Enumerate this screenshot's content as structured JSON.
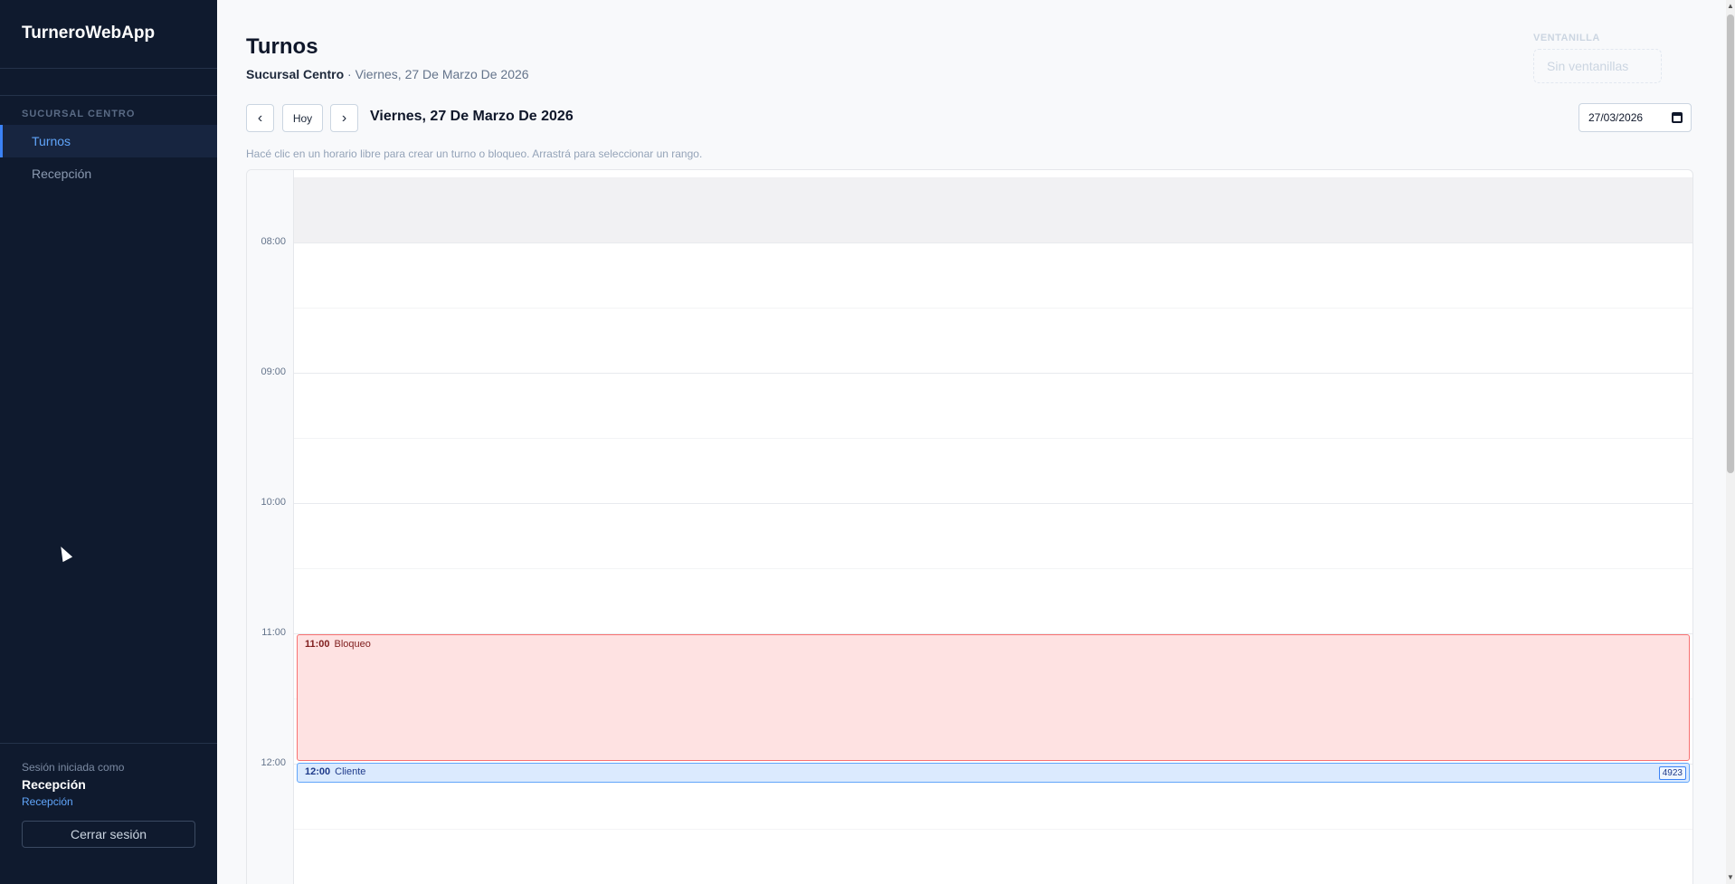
{
  "app": {
    "brand": "TurneroWebApp"
  },
  "sidebar": {
    "section": "SUCURSAL CENTRO",
    "items": [
      {
        "label": "Turnos",
        "active": true
      },
      {
        "label": "Recepción",
        "active": false
      }
    ],
    "session_label": "Sesión iniciada como",
    "user": "Recepción",
    "role": "Recepción",
    "logout_label": "Cerrar sesión"
  },
  "header": {
    "title": "Turnos",
    "branch": "Sucursal Centro",
    "separator": " · ",
    "date": "Viernes, 27 De Marzo De 2026",
    "ventanilla_label": "VENTANILLA",
    "ventanilla_placeholder": "Sin ventanillas"
  },
  "toolbar": {
    "prev": "‹",
    "today": "Hoy",
    "next": "›",
    "date_heading": "Viernes, 27 De Marzo De 2026",
    "date_value": "27/03/2026"
  },
  "hint": "Hacé clic en un horario libre para crear un turno o bloqueo. Arrastrá para seleccionar un rango.",
  "calendar": {
    "hours": [
      "08:00",
      "09:00",
      "10:00",
      "11:00",
      "12:00"
    ],
    "events": [
      {
        "time": "11:00",
        "label": "Bloqueo",
        "type": "block"
      },
      {
        "time": "12:00",
        "label": "Cliente",
        "type": "client",
        "badge": "4923"
      }
    ]
  },
  "colors": {
    "sidebar_bg": "#0f1a2e",
    "accent": "#3b82f6",
    "block_bg": "#fee2e2",
    "block_border": "#f87171",
    "client_bg": "#dbeafe"
  }
}
